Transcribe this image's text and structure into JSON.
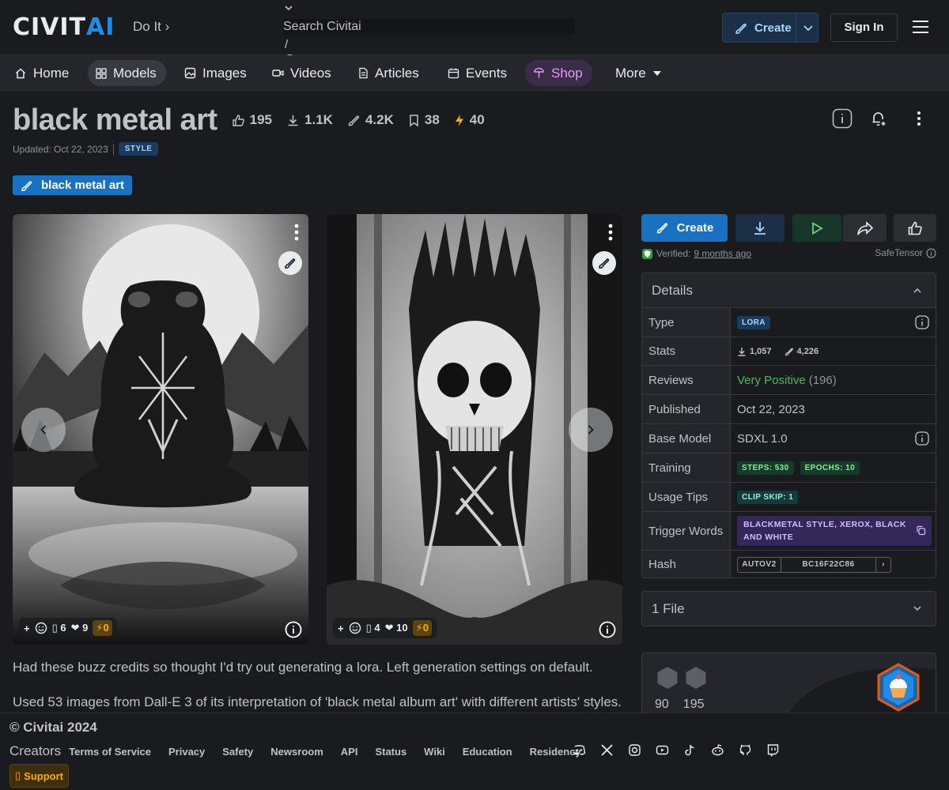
{
  "header": {
    "logo_civ": "CIVIT",
    "logo_ai": "AI",
    "tagline": "Do It",
    "search_placeholder": "Search Civitai",
    "search_shortcut": "/",
    "create_label": "Create",
    "signin_label": "Sign In"
  },
  "nav": {
    "items": [
      {
        "label": "Home",
        "icon": "home-icon"
      },
      {
        "label": "Models",
        "icon": "grid-icon"
      },
      {
        "label": "Images",
        "icon": "photo-icon"
      },
      {
        "label": "Videos",
        "icon": "video-icon"
      },
      {
        "label": "Articles",
        "icon": "file-icon"
      },
      {
        "label": "Events",
        "icon": "calendar-icon"
      },
      {
        "label": "Shop",
        "icon": "shop-icon"
      },
      {
        "label": "More",
        "icon": "caret-down-icon"
      }
    ]
  },
  "model": {
    "title": "black metal art",
    "likes": "195",
    "downloads": "1.1K",
    "generations": "4.2K",
    "collected": "38",
    "buzz": "40",
    "updated": "Updated: Oct 22, 2023",
    "type_badge": "STYLE",
    "version_tag": "black metal art"
  },
  "gallery": {
    "cards": [
      {
        "reactions": "6",
        "hearts": "9",
        "buzz": "0"
      },
      {
        "reactions": "4",
        "hearts": "10",
        "buzz": "0"
      }
    ]
  },
  "description": {
    "p1": "Had these buzz credits so thought I'd try out generating a lora. Left generation settings on default.",
    "p2": "Used 53 images from Dall-E 3 of its interpretation of 'black metal album art' with different artists' styles."
  },
  "sidebar": {
    "create_label": "Create",
    "verified_label": "Verified:",
    "verified_when": "9 months ago",
    "safetensor": "SafeTensor",
    "details_title": "Details",
    "rows": {
      "type_key": "Type",
      "type_val": "LORA",
      "stats_key": "Stats",
      "stats_downloads": "1,057",
      "stats_generations": "4,226",
      "reviews_key": "Reviews",
      "reviews_val": "Very Positive",
      "reviews_count": "(196)",
      "published_key": "Published",
      "published_val": "Oct 22, 2023",
      "base_key": "Base Model",
      "base_val": "SDXL 1.0",
      "training_key": "Training",
      "training_steps": "STEPS: 530",
      "training_epochs": "EPOCHS: 10",
      "usage_key": "Usage Tips",
      "usage_val": "CLIP SKIP: 1",
      "trigger_key": "Trigger Words",
      "trigger_val": "BLACKMETAL STYLE, XEROX, BLACK AND WHITE",
      "hash_key": "Hash",
      "hash_type": "AUTOV2",
      "hash_val": "BC16F22C86"
    },
    "files_label": "1 File",
    "creator_stat_a": "90",
    "creator_stat_b": "195"
  },
  "footer": {
    "copyright": "© Civitai 2024",
    "creators": "Creators",
    "links": [
      "Terms of Service",
      "Privacy",
      "Safety",
      "Newsroom",
      "API",
      "Status",
      "Wiki",
      "Education",
      "Residency"
    ],
    "support": "Support"
  },
  "colors": {
    "accent": "#228be6",
    "create_btn": "#1971c2",
    "positive": "#40c057",
    "buzz": "#fab005",
    "shop": "#e599f7"
  }
}
